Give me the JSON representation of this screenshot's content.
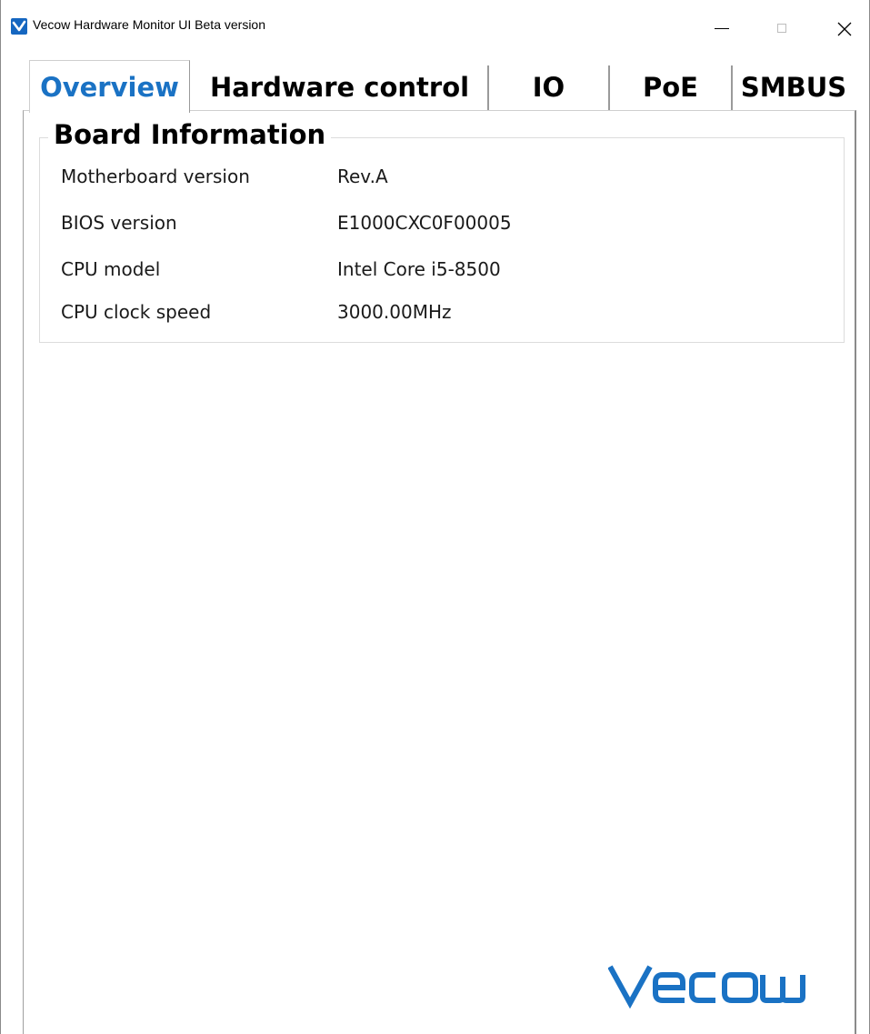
{
  "window": {
    "title": "Vecow Hardware Monitor UI Beta version",
    "icon": "vecow-checkmark-icon"
  },
  "tabs": [
    {
      "label": "Overview",
      "active": true
    },
    {
      "label": "Hardware control",
      "active": false
    },
    {
      "label": "IO",
      "active": false
    },
    {
      "label": "PoE",
      "active": false
    },
    {
      "label": "SMBUS",
      "active": false
    }
  ],
  "board_information": {
    "title": "Board Information",
    "rows": [
      {
        "label": "Motherboard version",
        "value": "Rev.A"
      },
      {
        "label": "BIOS version",
        "value": "E1000CXC0F00005"
      },
      {
        "label": "CPU model",
        "value": "Intel Core i5-8500"
      },
      {
        "label": "CPU clock speed",
        "value": "3000.00MHz"
      }
    ]
  },
  "logo": {
    "text": "Vecow",
    "color": "#1a72c4"
  },
  "colors": {
    "accent": "#1a72c4",
    "app_icon": "#1566c0"
  }
}
